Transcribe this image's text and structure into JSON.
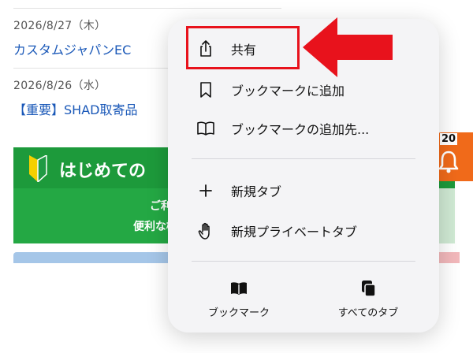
{
  "background": {
    "news": [
      {
        "date": "2026/8/27（木）",
        "title": "カスタムジャパンEC"
      },
      {
        "date": "2026/8/26（水）",
        "title": "【重要】SHAD取寄品"
      }
    ],
    "banner": {
      "heading": "はじめての",
      "line1": "ご利用方法",
      "line2": "便利な機能をご紹"
    },
    "notification": {
      "count": "20"
    }
  },
  "menu": {
    "items": [
      {
        "label": "共有",
        "icon": "share-icon"
      },
      {
        "label": "ブックマークに追加",
        "icon": "bookmark-icon"
      },
      {
        "label": "ブックマークの追加先...",
        "icon": "book-open-icon"
      },
      {
        "label": "新規タブ",
        "icon": "plus-icon"
      },
      {
        "label": "新規プライベートタブ",
        "icon": "hand-icon"
      }
    ],
    "bottom": [
      {
        "label": "ブックマーク",
        "icon": "bookmarks-icon"
      },
      {
        "label": "すべてのタブ",
        "icon": "tabs-icon"
      }
    ]
  },
  "colors": {
    "highlight": "#e8121c",
    "arrow": "#e8121c",
    "link": "#1a58b8",
    "banner_green": "#24a844",
    "notif_orange": "#f06a1a"
  }
}
